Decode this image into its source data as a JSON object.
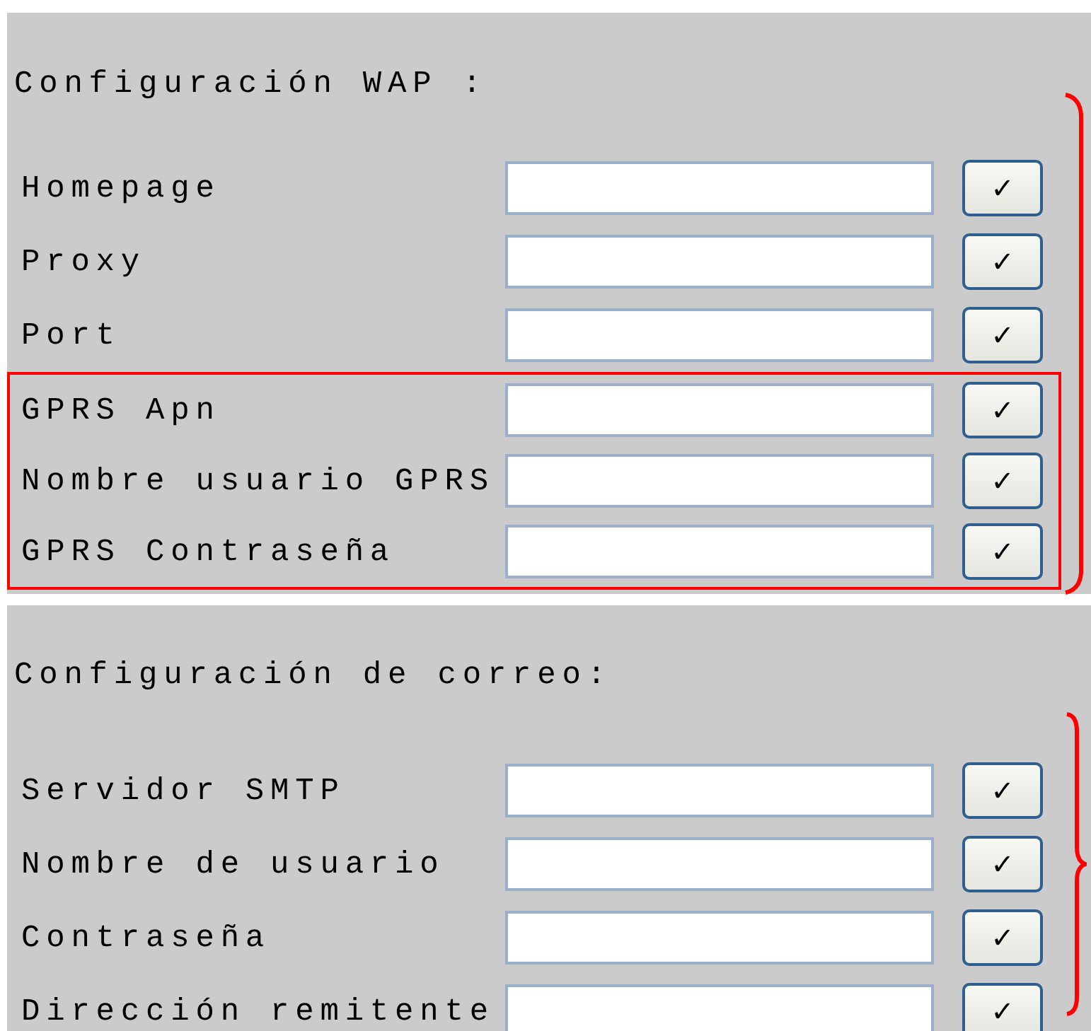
{
  "sections": [
    {
      "title": "Configuración WAP :",
      "rows": [
        {
          "label": "Homepage",
          "button": "✓",
          "highlighted": false
        },
        {
          "label": "Proxy",
          "button": "✓",
          "highlighted": false
        },
        {
          "label": "Port",
          "button": "✓",
          "highlighted": false
        },
        {
          "label": "GPRS Apn",
          "button": "✓",
          "highlighted": true
        },
        {
          "label": "Nombre usuario GPRS",
          "button": "✓",
          "highlighted": true
        },
        {
          "label": "GPRS Contraseña",
          "button": "✓",
          "highlighted": true
        }
      ]
    },
    {
      "title": "Configuración de correo:",
      "rows": [
        {
          "label": "Servidor SMTP",
          "button": "✓",
          "highlighted": false
        },
        {
          "label": "Nombre de usuario",
          "button": "✓",
          "highlighted": false
        },
        {
          "label": "Contraseña",
          "button": "✓",
          "highlighted": false
        },
        {
          "label": "Dirección remitente",
          "button": "✓",
          "highlighted": false
        }
      ]
    }
  ]
}
